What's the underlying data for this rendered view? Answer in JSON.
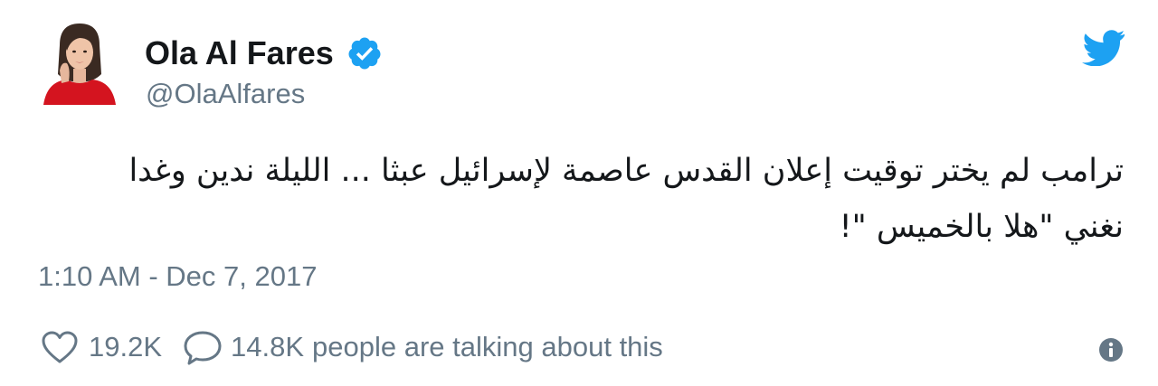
{
  "tweet": {
    "author": {
      "display_name": "Ola Al Fares",
      "handle": "@OlaAlfares",
      "verified_icon": "verified-badge-icon",
      "avatar": "profile-photo"
    },
    "text": "ترامب لم يختر توقيت إعلان القدس عاصمة لإسرائيل عبثا ... الليلة  ندين وغدا\nنغني  \"هلا بالخميس \"!",
    "timestamp": "1:10 AM - Dec 7, 2017",
    "likes": {
      "icon": "heart-icon",
      "count": "19.2K"
    },
    "conversation": {
      "icon": "reply-icon",
      "count": "14.8K",
      "suffix": "people are talking about this"
    },
    "brand_icon": "twitter-bird-icon",
    "info_icon": "info-icon"
  },
  "colors": {
    "text_primary": "#14171a",
    "text_secondary": "#657786",
    "twitter_blue": "#1da1f2",
    "avatar_dress": "#d4141f"
  }
}
